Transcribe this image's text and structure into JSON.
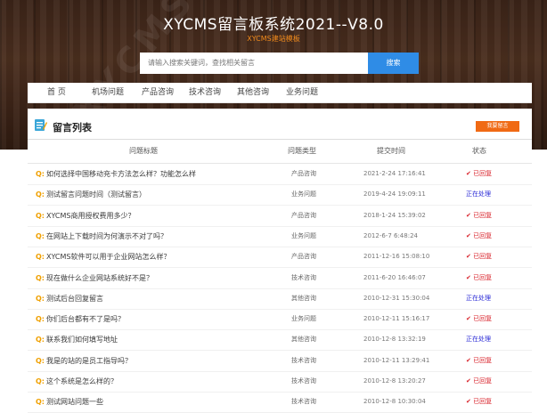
{
  "header": {
    "watermark": "XYCMS",
    "title": "XYCMS留言板系统2021--V8.0",
    "subtitle": "XYCMS建站模板",
    "search_placeholder": "请输入搜索关键词，查找相关留言",
    "search_button": "搜索"
  },
  "nav": [
    "首 页",
    "机场问题",
    "产品咨询",
    "技术咨询",
    "其他咨询",
    "业务问题"
  ],
  "panel": {
    "title": "留言列表",
    "post_button": "我要留言",
    "columns": [
      "问题标题",
      "问题类型",
      "提交时间",
      "状态"
    ]
  },
  "rows": [
    {
      "q": "Q:",
      "title": "如何选择中国移动充卡方法怎么样？功能怎么样",
      "type": "产品咨询",
      "time": "2021-2-24 17:16:41",
      "status": "已回复",
      "state": "ok"
    },
    {
      "q": "Q:",
      "title": "测试留言问题时间（测试留言）",
      "type": "业务问题",
      "time": "2019-4-24 19:09:11",
      "status": "正在处理",
      "state": "pend"
    },
    {
      "q": "Q:",
      "title": "XYCMS商用授权费用多少？",
      "type": "产品咨询",
      "time": "2018-1-24 15:39:02",
      "status": "已回复",
      "state": "ok"
    },
    {
      "q": "Q:",
      "title": "在网站上下载时间为何演示不对了吗？",
      "type": "业务问题",
      "time": "2012-6-7 6:48:24",
      "status": "已回复",
      "state": "ok"
    },
    {
      "q": "Q:",
      "title": "XYCMS软件可以用于企业网站怎么样？",
      "type": "产品咨询",
      "time": "2011-12-16 15:08:10",
      "status": "已回复",
      "state": "ok"
    },
    {
      "q": "Q:",
      "title": "现在做什么企业网站系统好不是？",
      "type": "技术咨询",
      "time": "2011-6-20 16:46:07",
      "status": "已回复",
      "state": "ok"
    },
    {
      "q": "Q:",
      "title": "测试后台回复留言",
      "type": "其他咨询",
      "time": "2010-12-31 15:30:04",
      "status": "正在处理",
      "state": "pend"
    },
    {
      "q": "Q:",
      "title": "你们后台都有不了是吗？",
      "type": "业务问题",
      "time": "2010-12-11 15:16:17",
      "status": "已回复",
      "state": "ok"
    },
    {
      "q": "Q:",
      "title": "联系我们如何填写地址",
      "type": "其他咨询",
      "time": "2010-12-8 13:32:19",
      "status": "正在处理",
      "state": "pend"
    },
    {
      "q": "Q:",
      "title": "我是的站的是员工指导吗？",
      "type": "技术咨询",
      "time": "2010-12-11 13:29:41",
      "status": "已回复",
      "state": "ok"
    },
    {
      "q": "Q:",
      "title": "这个系统是怎么样的？",
      "type": "技术咨询",
      "time": "2010-12-8 13:20:27",
      "status": "已回复",
      "state": "ok"
    },
    {
      "q": "Q:",
      "title": "测试网站问题一些",
      "type": "技术咨询",
      "time": "2010-12-8 10:30:04",
      "status": "已回复",
      "state": "ok"
    }
  ]
}
